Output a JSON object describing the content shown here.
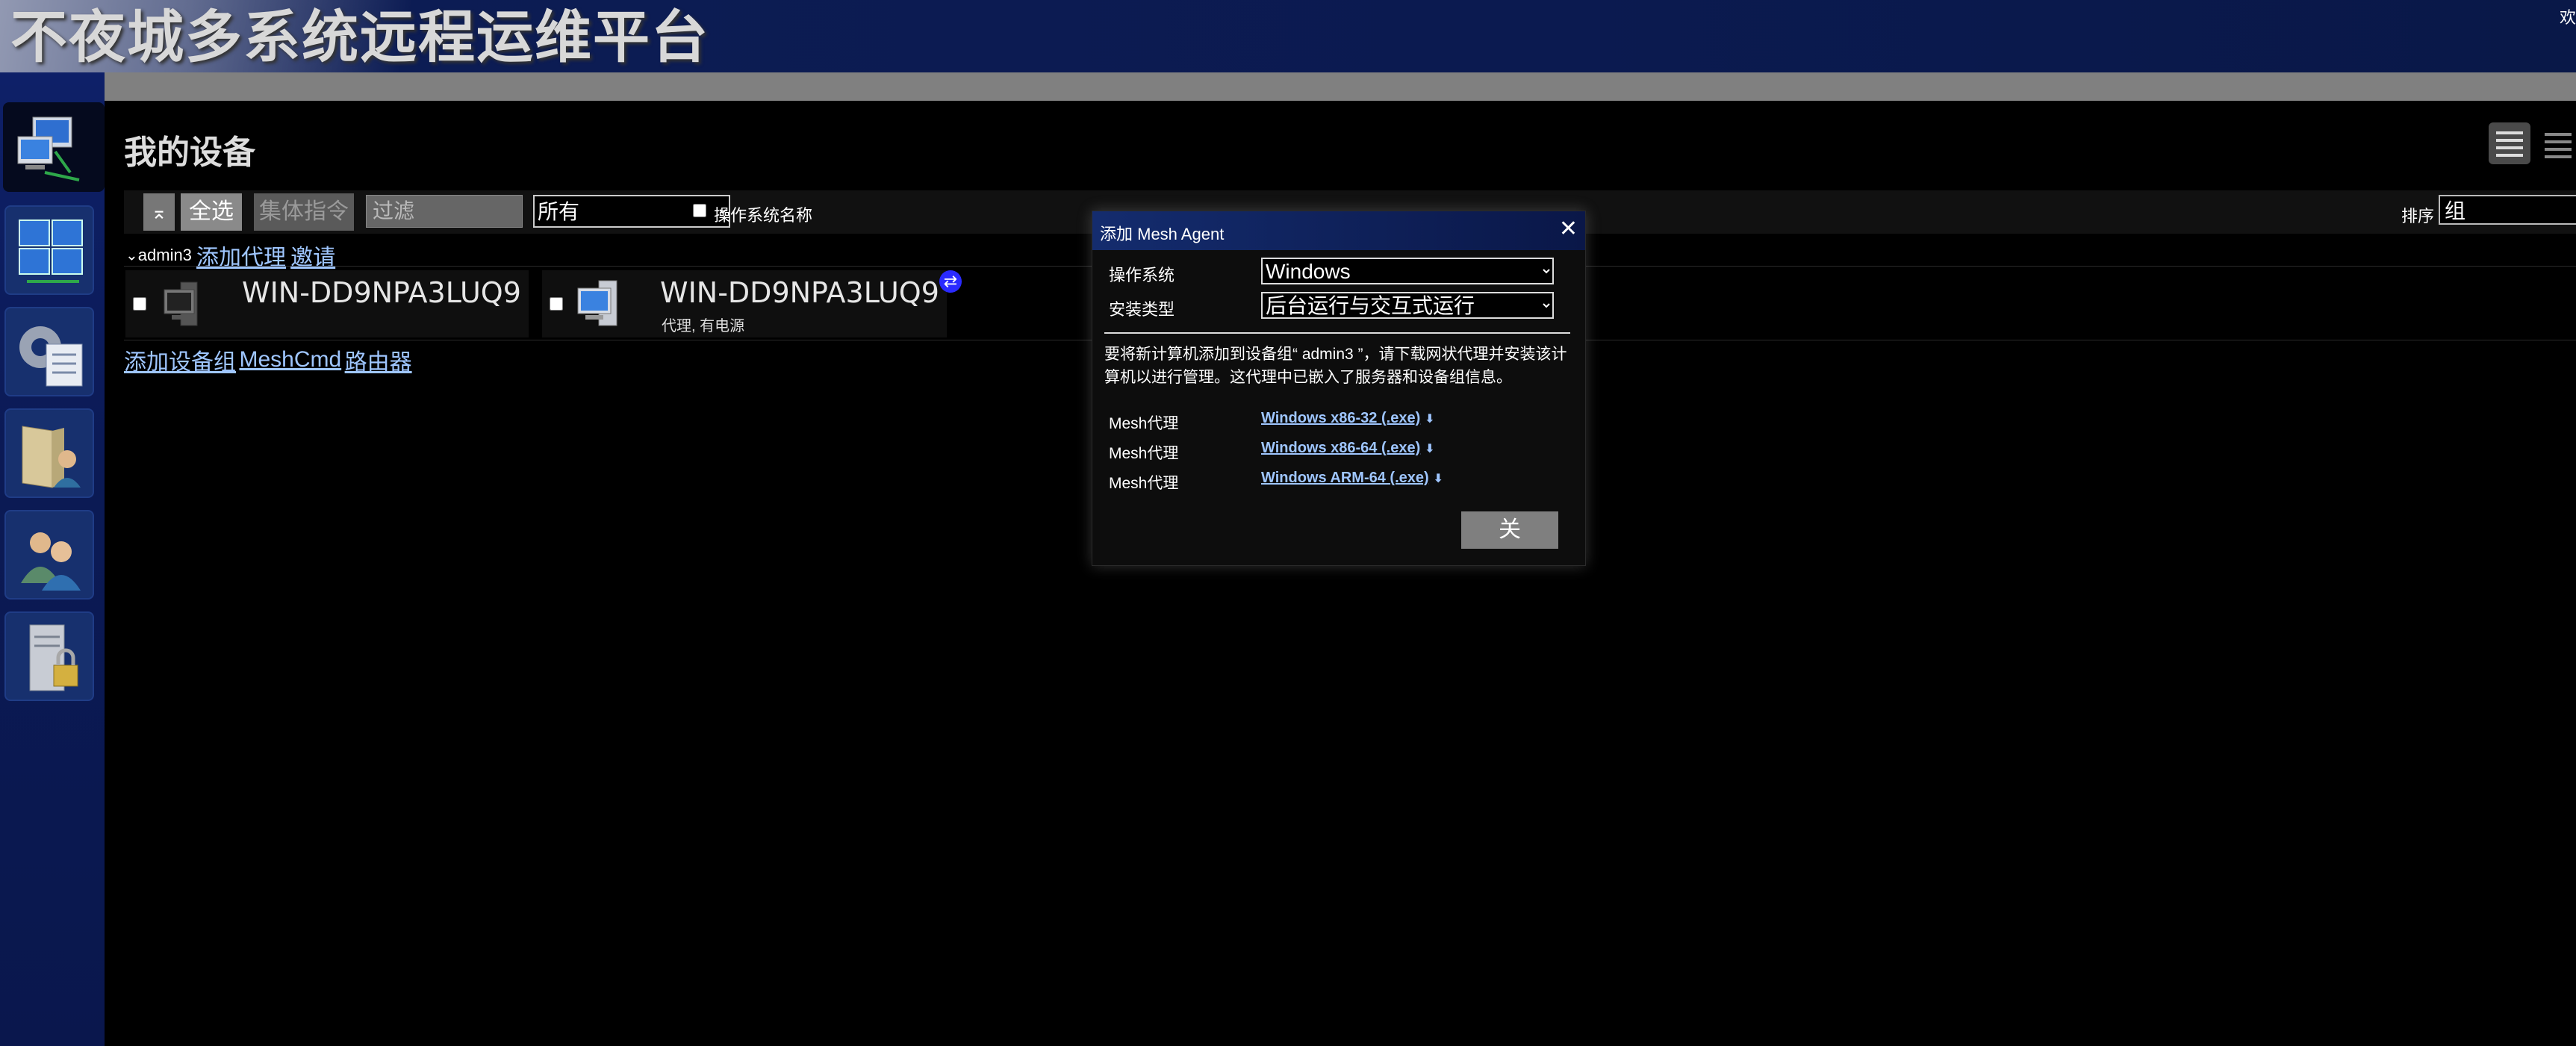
{
  "header": {
    "app_title": "不夜城多系统远程运维平台",
    "user_corner": "欢"
  },
  "leftrail": {
    "items": [
      {
        "name": "my-devices",
        "icon": "network-computers-icon",
        "active": true
      },
      {
        "name": "my-desktops",
        "icon": "windows-tiles-icon"
      },
      {
        "name": "settings",
        "icon": "gear-document-icon"
      },
      {
        "name": "my-files",
        "icon": "folder-user-icon"
      },
      {
        "name": "users",
        "icon": "users-icon"
      },
      {
        "name": "server",
        "icon": "server-lock-icon"
      }
    ]
  },
  "main": {
    "title": "我的设备",
    "toolbar": {
      "collapse_label": "⌅",
      "select_all_label": "全选",
      "group_command_label": "集体指令",
      "filter_placeholder": "过滤",
      "filter_value": "所有",
      "os_name_label": "操作系统名称",
      "sort_label": "排序",
      "sort_value": "组"
    },
    "group": {
      "name": "admin3",
      "add_agent": "添加代理",
      "invite": "邀请"
    },
    "devices": [
      {
        "name": "WIN-DD9NPA3LUQ9",
        "status": ""
      },
      {
        "name": "WIN-DD9NPA3LUQ9",
        "status": "代理, 有电源",
        "badge": "⇄"
      }
    ],
    "bottom_links": {
      "add_group": "添加设备组",
      "meshcmd": "MeshCmd",
      "router": "路由器"
    }
  },
  "dialog": {
    "title": "添加 Mesh Agent",
    "close_icon": "✕",
    "os_label": "操作系统",
    "os_value": "Windows",
    "install_label": "安装类型",
    "install_value": "后台运行与交互式运行",
    "description": "要将新计算机添加到设备组“ admin3 ”，请下载网状代理并安装该计算机以进行管理。这代理中已嵌入了服务器和设备组信息。",
    "agents": [
      {
        "label": "Mesh代理",
        "link": "Windows x86-32 (.exe)"
      },
      {
        "label": "Mesh代理",
        "link": "Windows x86-64 (.exe)"
      },
      {
        "label": "Mesh代理",
        "link": "Windows ARM-64 (.exe)"
      }
    ],
    "close_button": "关"
  },
  "colors": {
    "header_bg": "#0b1a50",
    "rail_bg": "#0b1a55",
    "link": "#9fc6ff",
    "button_gray": "#8c8c8c"
  }
}
